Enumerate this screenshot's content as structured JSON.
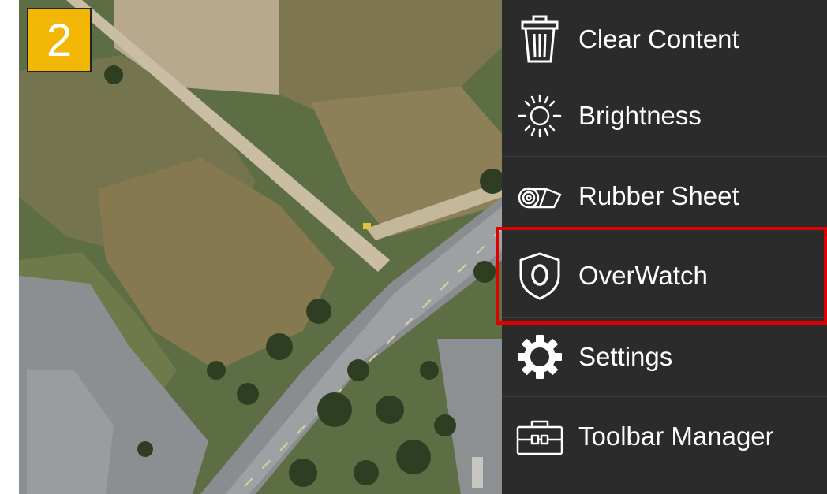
{
  "step_badge": "2",
  "menu": {
    "items": [
      {
        "label": "Clear Content",
        "icon": "trash-icon"
      },
      {
        "label": "Brightness",
        "icon": "sun-icon"
      },
      {
        "label": "Rubber Sheet",
        "icon": "rubber-sheet-icon"
      },
      {
        "label": "OverWatch",
        "icon": "shield-icon"
      },
      {
        "label": "Settings",
        "icon": "gear-icon"
      },
      {
        "label": "Toolbar Manager",
        "icon": "toolbox-icon"
      }
    ],
    "highlighted_item": "OverWatch"
  },
  "colors": {
    "menu_bg": "#2b2b2b",
    "badge_bg": "#f2b705",
    "highlight": "#e00000"
  }
}
